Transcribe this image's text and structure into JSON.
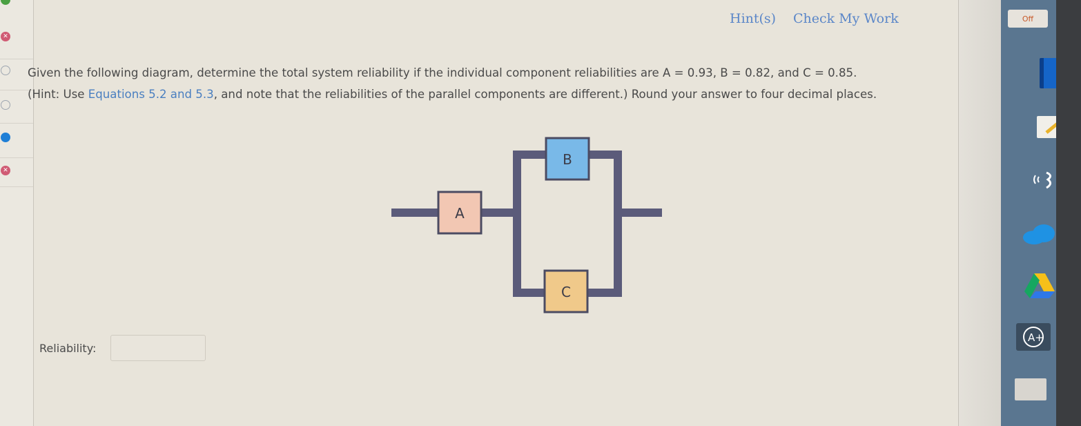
{
  "header": {
    "hints_label": "Hint(s)",
    "check_label": "Check My Work"
  },
  "question": {
    "line1": "Given the following diagram, determine the total system reliability if the individual component reliabilities are A = 0.93, B = 0.82, and C = 0.85.",
    "line2_prefix": "(Hint: Use ",
    "line2_link": "Equations 5.2 and 5.3",
    "line2_suffix": ", and note that the reliabilities of the parallel components are different.) Round your answer to four decimal places."
  },
  "diagram": {
    "components": [
      {
        "label": "A",
        "fill": "#f2c7b3"
      },
      {
        "label": "B",
        "fill": "#79b9e8"
      },
      {
        "label": "C",
        "fill": "#f0c98a"
      }
    ],
    "wire_color": "#5b5b7a"
  },
  "answer": {
    "label": "Reliability:",
    "value": ""
  },
  "taskbar": {
    "top_badge": "Off"
  }
}
